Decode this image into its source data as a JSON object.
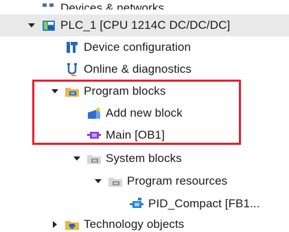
{
  "tree": {
    "items": [
      {
        "label": "Devices & networks",
        "icon": "devices-networks-icon"
      },
      {
        "label": "PLC_1 [CPU 1214C DC/DC/DC]",
        "icon": "plc-icon"
      },
      {
        "label": "Device configuration",
        "icon": "device-configuration-icon"
      },
      {
        "label": "Online & diagnostics",
        "icon": "online-diagnostics-icon"
      },
      {
        "label": "Program blocks",
        "icon": "folder-icon"
      },
      {
        "label": "Add new block",
        "icon": "add-block-icon"
      },
      {
        "label": "Main [OB1]",
        "icon": "organization-block-icon"
      },
      {
        "label": "System blocks",
        "icon": "folder-icon"
      },
      {
        "label": "Program resources",
        "icon": "folder-icon"
      },
      {
        "label": "PID_Compact [FB1...",
        "icon": "function-block-icon"
      },
      {
        "label": "Technology objects",
        "icon": "technology-folder-icon"
      }
    ]
  },
  "colors": {
    "highlight_border": "#f21a2a",
    "selected_row": "#e9e9e9",
    "folder": "#e8b84a",
    "ob_block": "#8a3fd9",
    "fb_block": "#2a7fd4"
  }
}
